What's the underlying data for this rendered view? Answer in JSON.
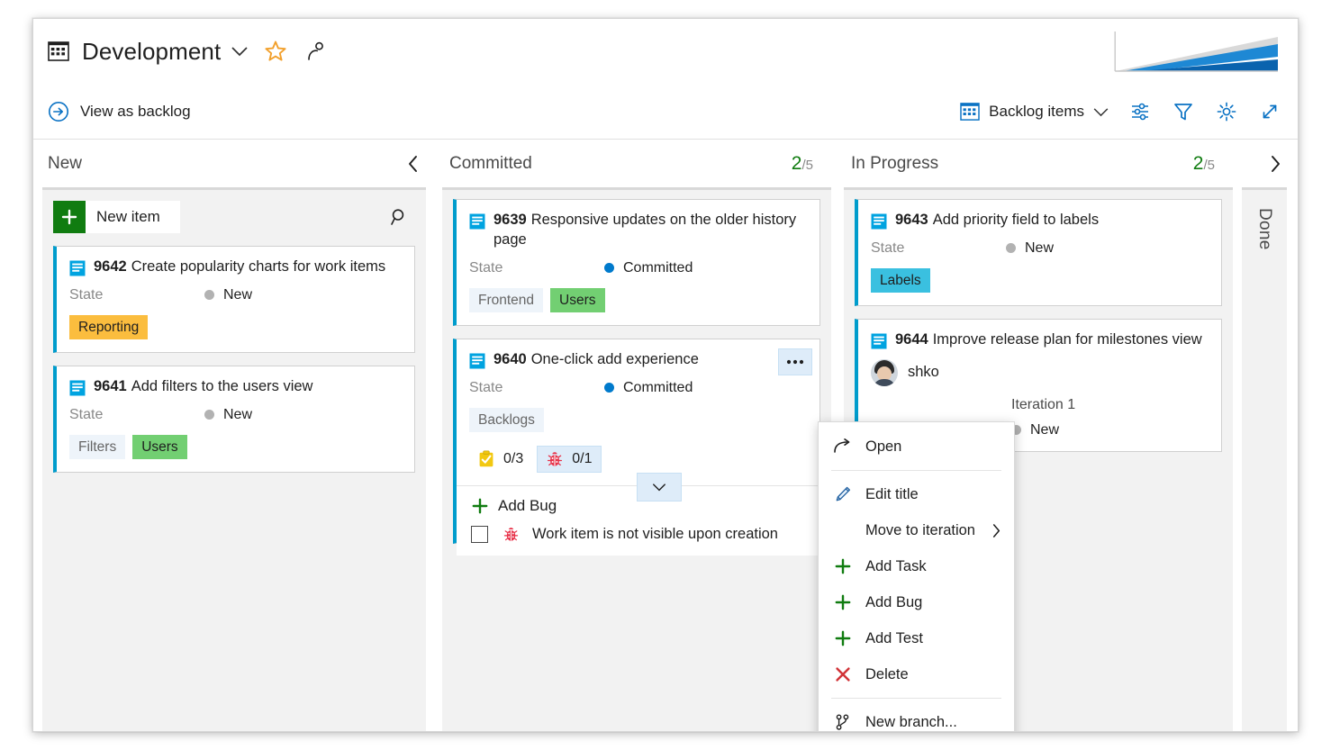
{
  "header": {
    "board_icon": "board-grid-icon",
    "title": "Development",
    "title_chevron": "chevron-down-icon",
    "favorite_icon": "star-icon",
    "team_icon": "team-members-icon",
    "cfd_sparkline": "cumulative-flow-diagram-sparkline",
    "view_as_backlog": "View as backlog",
    "view_as_backlog_icon": "arrow-right-circle-icon",
    "backlog_pivot_label": "Backlog items",
    "backlog_pivot_icon": "board-grid-icon",
    "backlog_pivot_chevron": "chevron-down-icon",
    "tools": [
      {
        "name": "board-settings-sliders-icon",
        "title": "Configure board settings"
      },
      {
        "name": "filter-funnel-icon",
        "title": "Filter"
      },
      {
        "name": "gear-icon",
        "title": "Settings"
      },
      {
        "name": "fullscreen-expand-icon",
        "title": "Enter full screen"
      }
    ]
  },
  "board": {
    "new_item_label": "New item",
    "search_icon": "search-icon",
    "columns": [
      {
        "id": "new",
        "name": "New",
        "wip": null,
        "collapse_icon": "chevron-left-icon",
        "has_new_item": true,
        "cards": [
          {
            "id": "9642",
            "title": "Create popularity charts for work items",
            "state_label": "State",
            "state": "New",
            "state_color": "#b2b2b2",
            "tags": [
              {
                "text": "Reporting",
                "color": "#fbbd3e"
              }
            ]
          },
          {
            "id": "9641",
            "title": "Add filters to the users view",
            "state_label": "State",
            "state": "New",
            "state_color": "#b2b2b2",
            "tags": [
              {
                "text": "Filters",
                "color": "#eef4fa"
              },
              {
                "text": "Users",
                "color": "#72cf72"
              }
            ]
          }
        ]
      },
      {
        "id": "committed",
        "name": "Committed",
        "wip": {
          "count": "2",
          "limit": "/5"
        },
        "cards": [
          {
            "id": "9639",
            "title": "Responsive updates on the older history page",
            "state_label": "State",
            "state": "Committed",
            "state_color": "#007acc",
            "tags": [
              {
                "text": "Frontend",
                "color": "#eef4fa"
              },
              {
                "text": "Users",
                "color": "#72cf72"
              }
            ]
          },
          {
            "id": "9640",
            "title": "One-click add experience",
            "state_label": "State",
            "state": "Committed",
            "state_color": "#007acc",
            "tags": [
              {
                "text": "Backlogs",
                "color": "#eef4fa"
              }
            ],
            "more_icon": "ellipsis-more-actions-icon",
            "counters": [
              {
                "icon": "task-clipboard-icon",
                "value": "0/3",
                "selected": false
              },
              {
                "icon": "bug-ladybug-icon",
                "value": "0/1",
                "selected": true
              }
            ],
            "counter_caret_icon": "chevron-down-icon",
            "add_panel": {
              "add_label": "Add Bug",
              "add_icon": "plus-icon",
              "checkbox_checked": false,
              "checkbox_icon": "bug-ladybug-icon",
              "note": "Work item is not visible upon creation"
            }
          }
        ]
      },
      {
        "id": "in-progress",
        "name": "In Progress",
        "wip": {
          "count": "2",
          "limit": "/5"
        },
        "cards": [
          {
            "id": "9643",
            "title": "Add priority field to labels",
            "state_label": "State",
            "state": "New",
            "state_color": "#b2b2b2",
            "tags": [
              {
                "text": "Labels",
                "color": "#3ac0e0"
              }
            ]
          },
          {
            "id": "9644",
            "title": "Improve release plan for milestones view",
            "assignee": "shko",
            "avatar": "user-avatar",
            "iteration": "Iteration 1",
            "state": "New",
            "state_color": "#b2b2b2"
          }
        ]
      },
      {
        "id": "done",
        "name": "Done",
        "collapsed": true,
        "expand_icon": "chevron-right-icon"
      }
    ]
  },
  "context_menu": {
    "items": [
      {
        "label": "Open",
        "icon": "open-item-arrow-icon",
        "submenu": false,
        "sep_after": true
      },
      {
        "label": "Edit title",
        "icon": "pencil-edit-icon",
        "submenu": false
      },
      {
        "label": "Move to iteration",
        "icon": "",
        "submenu": true
      },
      {
        "label": "Add Task",
        "icon": "plus-icon",
        "submenu": false
      },
      {
        "label": "Add Bug",
        "icon": "plus-icon",
        "submenu": false
      },
      {
        "label": "Add Test",
        "icon": "plus-icon",
        "submenu": false
      },
      {
        "label": "Delete",
        "icon": "delete-x-icon",
        "submenu": false,
        "sep_after": true
      },
      {
        "label": "New branch...",
        "icon": "git-branch-icon",
        "submenu": false
      }
    ]
  },
  "colors": {
    "accent_blue": "#0078d4",
    "card_stripe": "#009ccc",
    "wip_green": "#107c10",
    "new_item_green": "#107c10",
    "delete_red": "#d13438",
    "bug_red": "#e8334a",
    "task_yellow": "#f2c811",
    "column_bg": "#f2f2f2"
  }
}
